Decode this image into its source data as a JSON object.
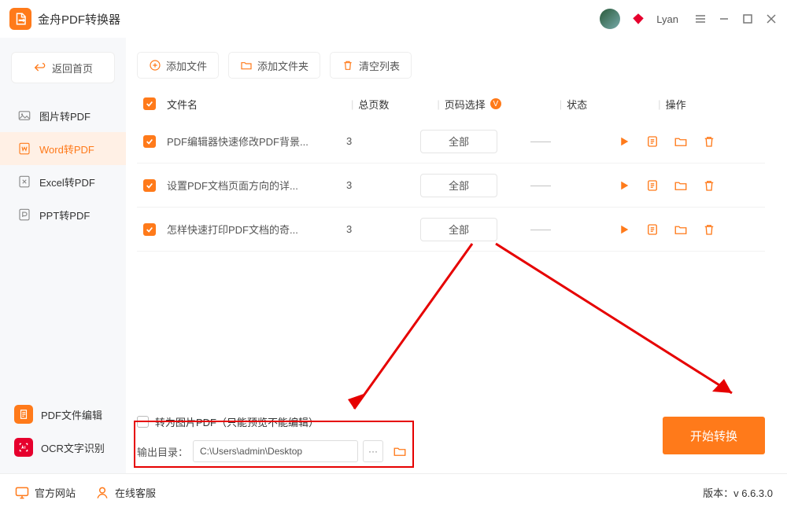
{
  "app": {
    "title": "金舟PDF转换器",
    "user": "Lyan"
  },
  "sidebar": {
    "back_label": "返回首页",
    "items": [
      {
        "label": "图片转PDF"
      },
      {
        "label": "Word转PDF"
      },
      {
        "label": "Excel转PDF"
      },
      {
        "label": "PPT转PDF"
      }
    ],
    "bottom": [
      {
        "label": "PDF文件编辑"
      },
      {
        "label": "OCR文字识别"
      }
    ]
  },
  "toolbar": {
    "add_file": "添加文件",
    "add_folder": "添加文件夹",
    "clear": "清空列表"
  },
  "table": {
    "headers": {
      "name": "文件名",
      "pages": "总页数",
      "sel": "页码选择",
      "status": "状态",
      "ops": "操作"
    },
    "rows": [
      {
        "name": "PDF编辑器快速修改PDF背景...",
        "pages": "3",
        "sel": "全部",
        "status": "——"
      },
      {
        "name": "设置PDF文档页面方向的详...",
        "pages": "3",
        "sel": "全部",
        "status": "——"
      },
      {
        "name": "怎样快速打印PDF文档的奇...",
        "pages": "3",
        "sel": "全部",
        "status": "——"
      }
    ]
  },
  "bottom": {
    "image_pdf_option": "转为图片PDF（只能预览不能编辑）",
    "output_label": "输出目录：",
    "output_path": "C:\\Users\\admin\\Desktop",
    "convert": "开始转换"
  },
  "statusbar": {
    "site": "官方网站",
    "support": "在线客服",
    "version_label": "版本：",
    "version": "v 6.6.3.0"
  }
}
